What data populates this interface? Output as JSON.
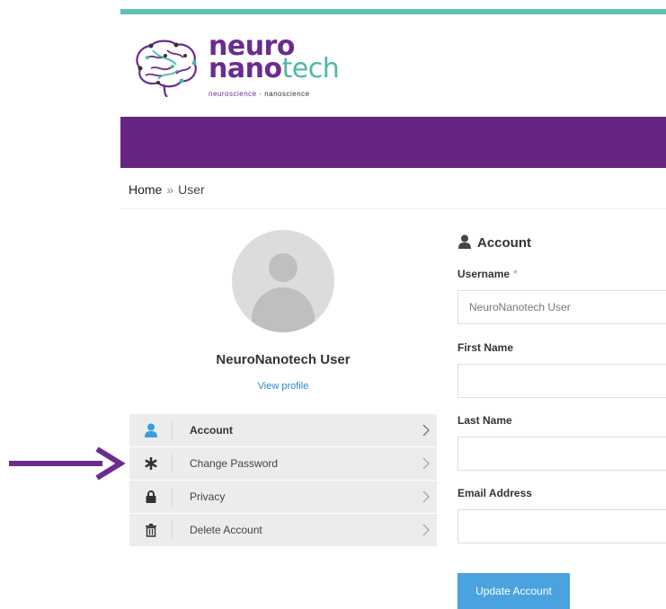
{
  "header": {
    "logo": {
      "word1": "neuro",
      "word2_a": "nano",
      "word2_b": "tech",
      "tagline_a": "neuroscience",
      "tagline_b": " · nanoscience"
    }
  },
  "colors": {
    "teal": "#5fc1b5",
    "purple": "#662583",
    "link": "#2a87c9",
    "button": "#4aa3df",
    "arrow": "#6a2c8e"
  },
  "breadcrumb": {
    "home": "Home",
    "separator": "»",
    "current": "User"
  },
  "profile": {
    "name": "NeuroNanotech User",
    "view_profile": "View profile"
  },
  "menu": {
    "items": [
      {
        "label": "Account",
        "icon": "user-icon",
        "active": true
      },
      {
        "label": "Change Password",
        "icon": "asterisk-icon",
        "active": false
      },
      {
        "label": "Privacy",
        "icon": "lock-icon",
        "active": false
      },
      {
        "label": "Delete Account",
        "icon": "trash-icon",
        "active": false
      }
    ]
  },
  "form": {
    "title": "Account",
    "title_icon": "user-icon",
    "username_label": "Username",
    "username_required": "*",
    "username_value": "NeuroNanotech User",
    "first_name_label": "First Name",
    "first_name_value": "",
    "last_name_label": "Last Name",
    "last_name_value": "",
    "email_label": "Email Address",
    "email_value": "",
    "submit_label": "Update Account"
  }
}
